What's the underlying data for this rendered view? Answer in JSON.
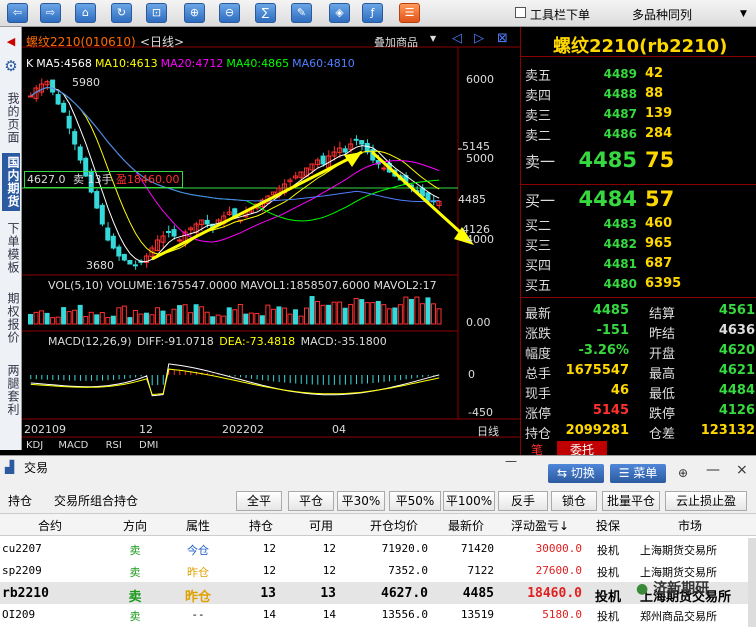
{
  "toolbar": {
    "buttons": [
      "back-icon",
      "forward-icon",
      "home-icon",
      "refresh-icon",
      "crop-icon",
      "zoom-in-icon",
      "zoom-out-icon",
      "formula-icon",
      "pen-icon",
      "tag-icon",
      "indicator-icon",
      "list-icon"
    ],
    "toolbar_label": "工具栏下单",
    "multi_label": "多品种同列",
    "dropdown_arrow": "▼"
  },
  "sidebar": {
    "items": [
      "我的页面",
      "国内期货",
      "下单模板",
      "期权报价",
      "两腿套利"
    ],
    "active_index": 1
  },
  "chart": {
    "title": "螺纹2210(010610)",
    "period": "<日线>",
    "overlay_label": "叠加商品",
    "ma": [
      {
        "label": "K",
        "color": "#ffffff"
      },
      {
        "label": "MA5:4568",
        "color": "#ffffff"
      },
      {
        "label": "MA10:4613",
        "color": "#ffff00"
      },
      {
        "label": "MA20:4712",
        "color": "#ff00ff"
      },
      {
        "label": "MA40:4865",
        "color": "#00ff00"
      },
      {
        "label": "MA60:4810",
        "color": "#4f7fff"
      }
    ],
    "price_axis": [
      "6000",
      "5145",
      "5000",
      "4126",
      "4000"
    ],
    "high_label": "5980",
    "low_label": "3680",
    "position_label": "4627.0",
    "position_side": "卖",
    "position_lots": "13手",
    "position_profit": "盈18460.00",
    "vol_header": "VOL(5,10) VOLUME:1675547.0000 MAVOL1:1858507.6000 MAVOL2:17",
    "vol_axis": "0.00",
    "macd_header": {
      "name": "MACD(12,26,9)",
      "diff": "DIFF:-91.0718",
      "dea": "DEA:-73.4818",
      "macd": "MACD:-35.1800"
    },
    "macd_axis": [
      "0",
      "-450"
    ],
    "dates": [
      "202109",
      "12",
      "202202",
      "04"
    ],
    "period_label": "日线",
    "sub_tabs": [
      "KDJ",
      "MACD",
      "RSI",
      "DMI"
    ]
  },
  "quote": {
    "title": "螺纹2210(rb2210)",
    "asks": [
      {
        "label": "卖五",
        "price": "4489",
        "vol": "42"
      },
      {
        "label": "卖四",
        "price": "4488",
        "vol": "88"
      },
      {
        "label": "卖三",
        "price": "4487",
        "vol": "139"
      },
      {
        "label": "卖二",
        "price": "4486",
        "vol": "284"
      },
      {
        "label": "卖一",
        "price": "4485",
        "vol": "75"
      }
    ],
    "bids": [
      {
        "label": "买一",
        "price": "4484",
        "vol": "57"
      },
      {
        "label": "买二",
        "price": "4483",
        "vol": "460"
      },
      {
        "label": "买三",
        "price": "4482",
        "vol": "965"
      },
      {
        "label": "买四",
        "price": "4481",
        "vol": "687"
      },
      {
        "label": "买五",
        "price": "4480",
        "vol": "6395"
      }
    ],
    "stats_left": [
      {
        "label": "最新",
        "value": "4485",
        "color": "#36d93f"
      },
      {
        "label": "涨跌",
        "value": "-151",
        "color": "#36d93f"
      },
      {
        "label": "幅度",
        "value": "-3.26%",
        "color": "#36d93f"
      },
      {
        "label": "总手",
        "value": "1675547",
        "color": "#ffd700"
      },
      {
        "label": "现手",
        "value": "46",
        "color": "#ffd700"
      },
      {
        "label": "涨停",
        "value": "5145",
        "color": "#ff3030"
      },
      {
        "label": "持仓",
        "value": "2099281",
        "color": "#ffd700"
      }
    ],
    "stats_right": [
      {
        "label": "结算",
        "value": "4561",
        "color": "#36d93f"
      },
      {
        "label": "昨结",
        "value": "4636",
        "color": "#dddddd"
      },
      {
        "label": "开盘",
        "value": "4620",
        "color": "#36d93f"
      },
      {
        "label": "最高",
        "value": "4621",
        "color": "#36d93f"
      },
      {
        "label": "最低",
        "value": "4484",
        "color": "#36d93f"
      },
      {
        "label": "跌停",
        "value": "4126",
        "color": "#36d93f"
      },
      {
        "label": "仓差",
        "value": "123132",
        "color": "#ffd700"
      }
    ],
    "tabs": [
      "笔",
      "委托"
    ]
  },
  "trade": {
    "title": "交易",
    "switch_label": "切换",
    "menu_label": "菜单",
    "minimize": "—",
    "close": "×"
  },
  "positions": {
    "tabs": [
      "持仓",
      "交易所组合持仓"
    ],
    "buttons": [
      "全平",
      "平仓",
      "平30%",
      "平50%",
      "平100%",
      "反手",
      "锁仓",
      "批量平仓",
      "云止损止盈"
    ],
    "headers": [
      "合约",
      "方向",
      "属性",
      "持仓",
      "可用",
      "开仓均价",
      "最新价",
      "浮动盈亏↓",
      "投保",
      "市场"
    ],
    "rows": [
      {
        "contract": "cu2207",
        "dir": "卖",
        "attr": "今仓",
        "hold": "12",
        "avail": "12",
        "open": "71920.0",
        "last": "71420",
        "pnl": "30000.0",
        "hedge": "投机",
        "market": "上海期货交易所"
      },
      {
        "contract": "sp2209",
        "dir": "卖",
        "attr": "昨仓",
        "hold": "12",
        "avail": "12",
        "open": "7352.0",
        "last": "7122",
        "pnl": "27600.0",
        "hedge": "投机",
        "market": "上海期货交易所"
      },
      {
        "contract": "rb2210",
        "dir": "卖",
        "attr": "昨仓",
        "hold": "13",
        "avail": "13",
        "open": "4627.0",
        "last": "4485",
        "pnl": "18460.0",
        "hedge": "投机",
        "market": "上海期货交易所"
      },
      {
        "contract": "OI209",
        "dir": "卖",
        "attr": "--",
        "hold": "14",
        "avail": "14",
        "open": "13556.0",
        "last": "13519",
        "pnl": "5180.0",
        "hedge": "投机",
        "market": "郑州商品交易所"
      }
    ],
    "selected_index": 2,
    "watermark": "济新期研"
  }
}
